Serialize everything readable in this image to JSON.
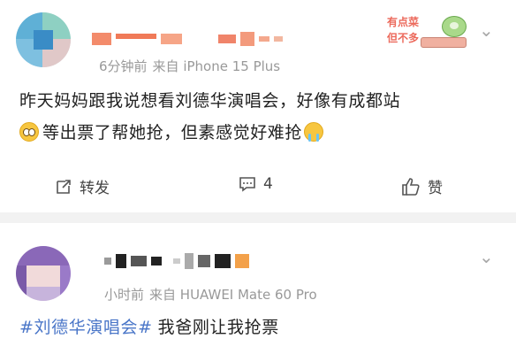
{
  "post1": {
    "meta_time": "6分钟前",
    "meta_source": "来自 iPhone 15 Plus",
    "body_line1": "昨天妈妈跟我说想看刘德华演唱会，好像有成都站",
    "body_line2a": "等出票了帮她抢，但素感觉好难抢",
    "sticker_text_1": "有点菜",
    "sticker_text_2": "但不多",
    "actions": {
      "repost": "转发",
      "comments": "4",
      "like": "赞"
    },
    "emoji": [
      "pleading-face",
      "crying-face"
    ]
  },
  "post2": {
    "meta_time": "小时前",
    "meta_source": "来自 HUAWEI Mate 60 Pro",
    "hashtag": "#刘德华演唱会#",
    "body": "我爸刚让我抢票"
  },
  "colors": {
    "hashtag": "#4a76c8",
    "background": "#f2f2f2",
    "card": "#ffffff",
    "meta": "#999999"
  }
}
